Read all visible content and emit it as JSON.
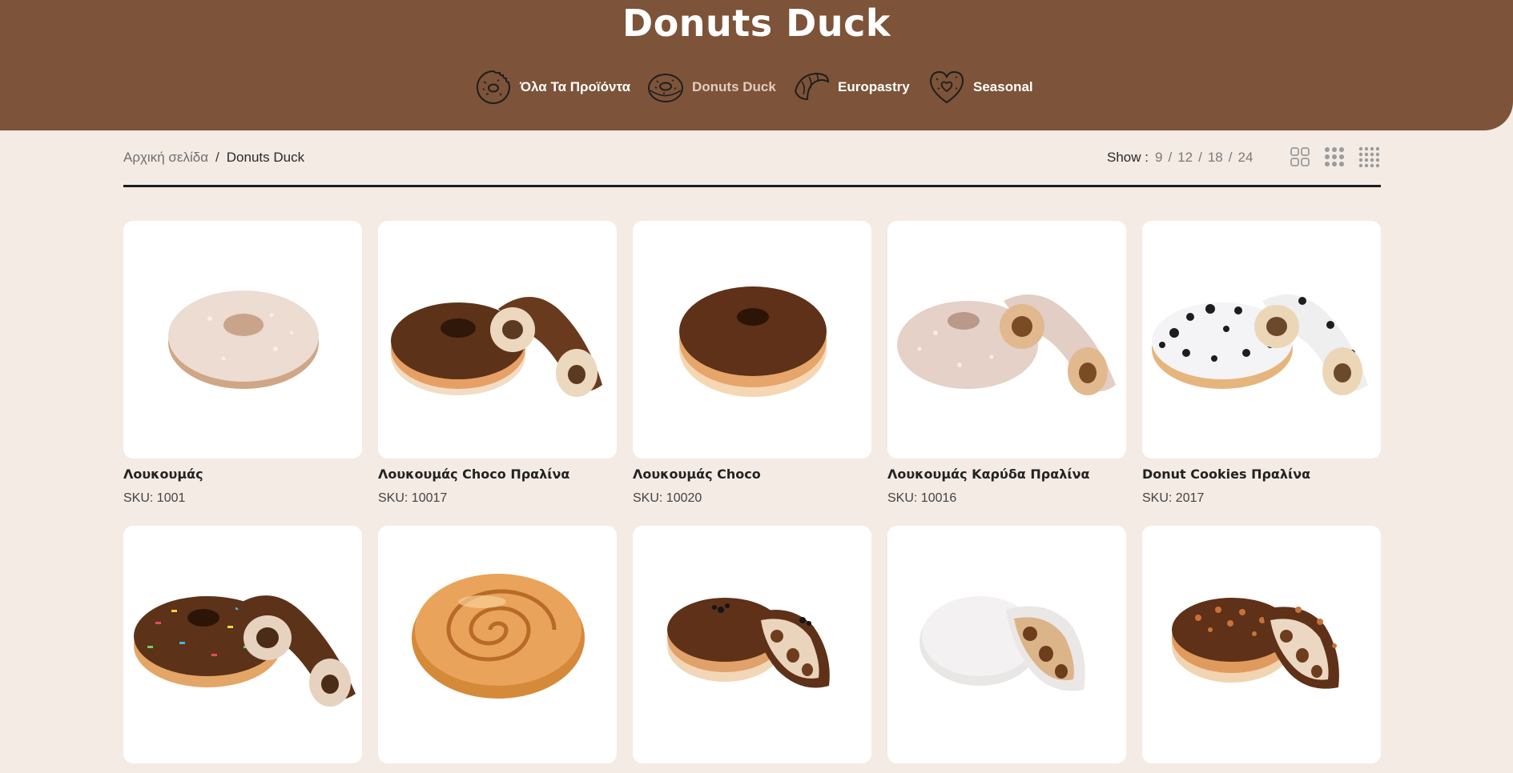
{
  "site": {
    "title": "Donuts Duck"
  },
  "nav": [
    {
      "label": "Όλα Τα Προϊόντα",
      "icon": "donut-bitten-icon",
      "active": false
    },
    {
      "label": "Donuts Duck",
      "icon": "donut-icon",
      "active": true
    },
    {
      "label": "Europastry",
      "icon": "croissant-icon",
      "active": false
    },
    {
      "label": "Seasonal",
      "icon": "heart-donut-icon",
      "active": false
    }
  ],
  "breadcrumb": {
    "home": "Αρχική σελίδα",
    "separator": "/",
    "current": "Donuts Duck"
  },
  "show": {
    "label": "Show :",
    "options": [
      "9",
      "12",
      "18",
      "24"
    ],
    "separator": "/"
  },
  "view_modes": [
    {
      "icon": "grid-2-icon",
      "columns": 2
    },
    {
      "icon": "grid-3-icon",
      "columns": 3
    },
    {
      "icon": "grid-4-icon",
      "columns": 4
    }
  ],
  "products": [
    {
      "name": "Λουκουμάς",
      "sku": "SKU: 1001"
    },
    {
      "name": "Λουκουμάς Choco Πραλίνα",
      "sku": "SKU: 10017"
    },
    {
      "name": "Λουκουμάς Choco",
      "sku": "SKU: 10020"
    },
    {
      "name": "Λουκουμάς Καρύδα Πραλίνα",
      "sku": "SKU: 10016"
    },
    {
      "name": "Donut Cookies Πραλίνα",
      "sku": "SKU: 2017"
    },
    {
      "name": "",
      "sku": ""
    },
    {
      "name": "",
      "sku": ""
    },
    {
      "name": "",
      "sku": ""
    },
    {
      "name": "",
      "sku": ""
    },
    {
      "name": "",
      "sku": ""
    }
  ],
  "colors": {
    "header_bg": "#7d5339",
    "page_bg": "#f3ebe4",
    "nav_active": "#e2cdbd",
    "divider": "#1c1c1c"
  }
}
